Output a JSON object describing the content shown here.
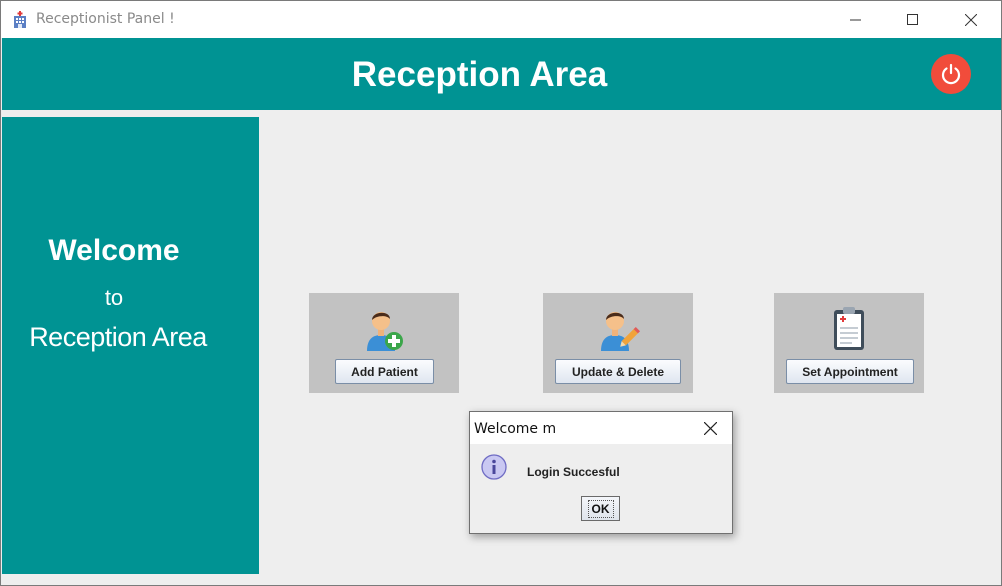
{
  "window": {
    "title": "Receptionist Panel !"
  },
  "header": {
    "title": "Reception Area"
  },
  "sidebar": {
    "line1": "Welcome",
    "line2": "to",
    "line3": "Reception Area"
  },
  "actions": [
    {
      "label": "Add Patient",
      "icon": "add-patient-icon"
    },
    {
      "label": "Update & Delete",
      "icon": "edit-patient-icon"
    },
    {
      "label": "Set Appointment",
      "icon": "clipboard-icon"
    }
  ],
  "dialog": {
    "title": "Welcome m",
    "message": "Login Succesful",
    "ok_label": "OK"
  },
  "colors": {
    "accent": "#009393",
    "power": "#f14c3b",
    "card": "#c2c2c2"
  }
}
